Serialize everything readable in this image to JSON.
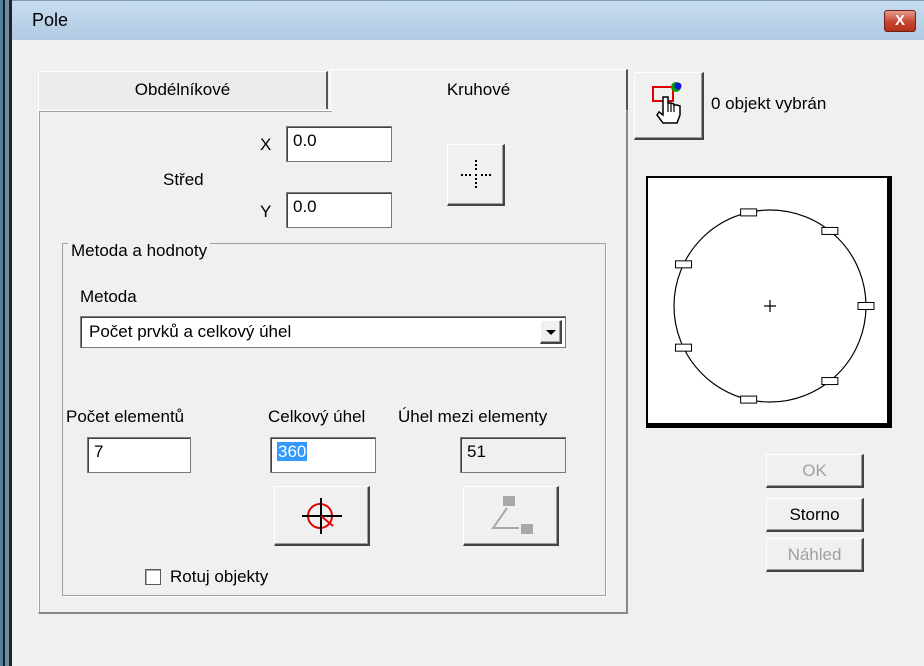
{
  "window": {
    "title": "Pole",
    "close_glyph": "X"
  },
  "tabs": [
    {
      "label": "Obdélníkové",
      "active": false
    },
    {
      "label": "Kruhové",
      "active": true
    }
  ],
  "selection": {
    "status": "0 objekt vybrán",
    "icon": "select-objects-icon"
  },
  "center": {
    "label": "Střed",
    "x_label": "X",
    "x_value": "0.0",
    "y_label": "Y",
    "y_value": "0.0",
    "pick_icon": "crosshair-pick-icon"
  },
  "method_group": {
    "legend": "Metoda a hodnoty",
    "method_label": "Metoda",
    "method_selected": "Počet prvků a celkový úhel",
    "count_label": "Počet elementů",
    "count_value": "7",
    "total_angle_label": "Celkový úhel",
    "total_angle_value": "360",
    "between_label": "Úhel mezi elementy",
    "between_value": "51",
    "angle_pick_icon": "angle-pick-icon",
    "between_pick_icon": "angle-between-icon"
  },
  "rotate": {
    "label": "Rotuj objekty",
    "checked": false
  },
  "preview": {
    "element_count": 7
  },
  "buttons": {
    "ok": "OK",
    "cancel": "Storno",
    "preview": "Náhled"
  }
}
